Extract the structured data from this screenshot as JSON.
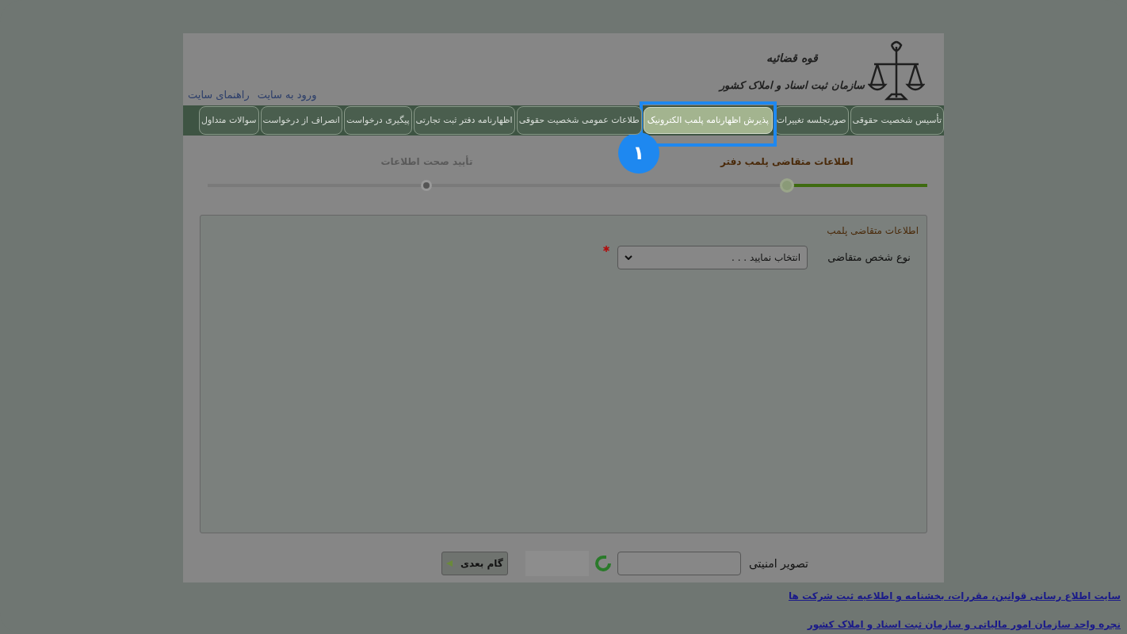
{
  "header": {
    "org_top": "قوه قضائیه",
    "org_name": "سازمان ثبت اسناد و املاک کشور",
    "links": [
      "ورود به سایت",
      "راهنمای سایت"
    ]
  },
  "nav": [
    {
      "label": "تأسیس شخصیت حقوقی",
      "selected": false
    },
    {
      "label": "صورتجلسه تغییرات",
      "selected": false
    },
    {
      "label": "پذیرش اظهارنامه پلمب الکترونیک",
      "selected": true
    },
    {
      "label": "طلاعات عمومی شخصیت حقوقی",
      "selected": false
    },
    {
      "label": "اظهارنامه دفتر ثبت تجارتی",
      "selected": false
    },
    {
      "label": "پیگیری درخواست",
      "selected": false
    },
    {
      "label": "انصراف از درخواست",
      "selected": false
    },
    {
      "label": "سوالات متداول",
      "selected": false
    }
  ],
  "callout": {
    "number": "۱"
  },
  "steps": [
    {
      "label": "اطلاعات متقاضی پلمب دفتر",
      "selected": true
    },
    {
      "label": "تأیید صحت اطلاعات",
      "selected": false
    }
  ],
  "form": {
    "title": "اطلاعات متقاضی پلمب",
    "fields": [
      {
        "label": "نوع شخص متقاضی",
        "value": "انتخاب نمایید . . .",
        "required": true
      }
    ]
  },
  "captcha": {
    "label": "تصویر امنیتی"
  },
  "next_button": "گام بعدی",
  "footer_links": [
    "سایت اطلاع رسانی قوانین، مقررات، بخشنامه و اطلاعیه ثبت شرکت ها",
    "نجره واحد سازمان امور مالیاتی و سازمان ثبت اسناد و املاک کشور"
  ]
}
